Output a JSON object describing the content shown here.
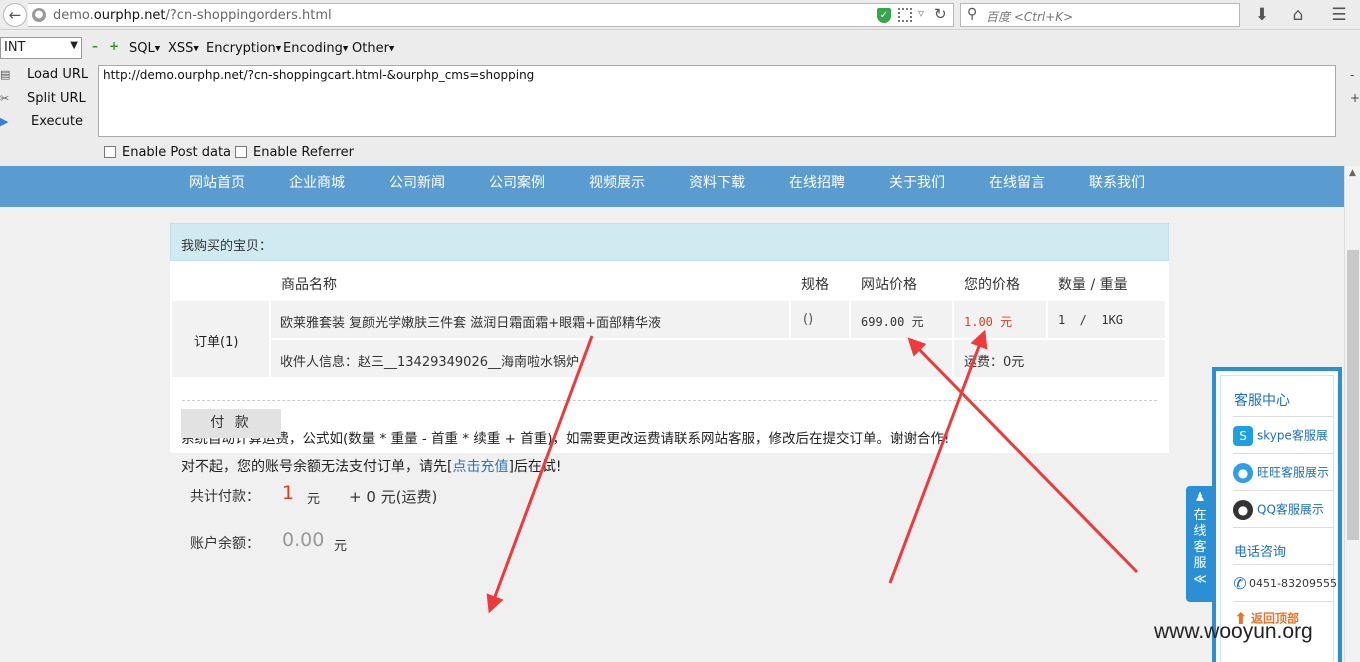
{
  "browser": {
    "url_prefix": "demo.",
    "url_domain": "ourphp.net",
    "url_path": "/?cn-shoppingorders.html",
    "search_placeholder": "百度 <Ctrl+K>"
  },
  "hackbar": {
    "select_value": "INT",
    "menus": [
      "SQL",
      "XSS",
      "Encryption",
      "Encoding",
      "Other"
    ],
    "load_url": "Load URL",
    "split_url": "Split URL",
    "execute": "Execute",
    "url_value": "http://demo.ourphp.net/?cn-shoppingcart.html-&ourphp_cms=shopping",
    "enable_post": "Enable Post data",
    "enable_referrer": "Enable Referrer"
  },
  "site_nav": [
    "网站首页",
    "企业商城",
    "公司新闻",
    "公司案例",
    "视频展示",
    "资料下载",
    "在线招聘",
    "关于我们",
    "在线留言",
    "联系我们"
  ],
  "order": {
    "heading": "我购买的宝贝：",
    "columns": {
      "name": "商品名称",
      "spec": "规格",
      "site_price": "网站价格",
      "your_price": "您的价格",
      "qty_weight": "数量 / 重量"
    },
    "order_label": "订单(1)",
    "product_name": "欧莱雅套装 复颜光学嫩肤三件套 滋润日霜面霜+眼霜+面部精华液",
    "spec": "()",
    "site_price": "699.00 元",
    "your_price": "1.00 元",
    "qty_weight": "1  /  1KG",
    "recipient": "收件人信息：赵三__13429349026__海南啦水锅炉",
    "shipping": "运费：0元",
    "notice": "系统自动计算运费，公式如(数量 * 重量 - 首重 * 续重 + 首重)，如需要更改运费请联系网站客服，修改后在提交订单。谢谢合作!"
  },
  "payment": {
    "total_label": "共计付款：",
    "total_value": "1",
    "total_unit": "元",
    "shipping_extra": "+ 0 元(运费)",
    "balance_label": "账户余额：",
    "balance_value": "0.00",
    "balance_unit": "元",
    "pay_button": "付 款",
    "sorry_prefix": "对不起，您的账号余额无法支付订单，请先[",
    "recharge_link": "点击充值",
    "sorry_suffix": "]后在试!"
  },
  "service": {
    "tab_text": "在线客服",
    "tab_arrow": "≪",
    "title": "客服中心",
    "items": [
      "skype客服展",
      "旺旺客服展示",
      "QQ客服展示"
    ],
    "phone_title": "电话咨询",
    "phone": "0451-83209555",
    "back_top": "返回顶部"
  },
  "watermark": "www.wooyun.org",
  "colors": {
    "nav_blue": "#5a9bd0",
    "price_red": "#e03c1e",
    "arrow_red": "#ee3a3a",
    "service_blue": "#2b8fd6"
  }
}
